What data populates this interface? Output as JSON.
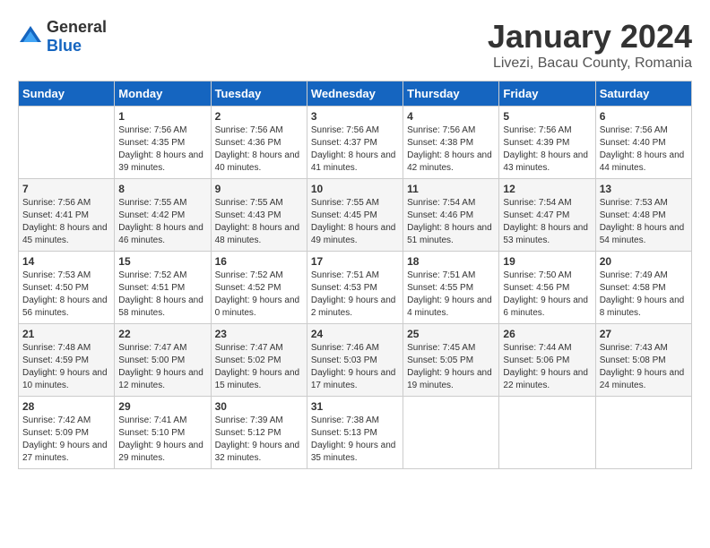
{
  "logo": {
    "general": "General",
    "blue": "Blue"
  },
  "title": "January 2024",
  "location": "Livezi, Bacau County, Romania",
  "days_of_week": [
    "Sunday",
    "Monday",
    "Tuesday",
    "Wednesday",
    "Thursday",
    "Friday",
    "Saturday"
  ],
  "weeks": [
    [
      {
        "day": "",
        "sunrise": "",
        "sunset": "",
        "daylight": ""
      },
      {
        "day": "1",
        "sunrise": "Sunrise: 7:56 AM",
        "sunset": "Sunset: 4:35 PM",
        "daylight": "Daylight: 8 hours and 39 minutes."
      },
      {
        "day": "2",
        "sunrise": "Sunrise: 7:56 AM",
        "sunset": "Sunset: 4:36 PM",
        "daylight": "Daylight: 8 hours and 40 minutes."
      },
      {
        "day": "3",
        "sunrise": "Sunrise: 7:56 AM",
        "sunset": "Sunset: 4:37 PM",
        "daylight": "Daylight: 8 hours and 41 minutes."
      },
      {
        "day": "4",
        "sunrise": "Sunrise: 7:56 AM",
        "sunset": "Sunset: 4:38 PM",
        "daylight": "Daylight: 8 hours and 42 minutes."
      },
      {
        "day": "5",
        "sunrise": "Sunrise: 7:56 AM",
        "sunset": "Sunset: 4:39 PM",
        "daylight": "Daylight: 8 hours and 43 minutes."
      },
      {
        "day": "6",
        "sunrise": "Sunrise: 7:56 AM",
        "sunset": "Sunset: 4:40 PM",
        "daylight": "Daylight: 8 hours and 44 minutes."
      }
    ],
    [
      {
        "day": "7",
        "sunrise": "Sunrise: 7:56 AM",
        "sunset": "Sunset: 4:41 PM",
        "daylight": "Daylight: 8 hours and 45 minutes."
      },
      {
        "day": "8",
        "sunrise": "Sunrise: 7:55 AM",
        "sunset": "Sunset: 4:42 PM",
        "daylight": "Daylight: 8 hours and 46 minutes."
      },
      {
        "day": "9",
        "sunrise": "Sunrise: 7:55 AM",
        "sunset": "Sunset: 4:43 PM",
        "daylight": "Daylight: 8 hours and 48 minutes."
      },
      {
        "day": "10",
        "sunrise": "Sunrise: 7:55 AM",
        "sunset": "Sunset: 4:45 PM",
        "daylight": "Daylight: 8 hours and 49 minutes."
      },
      {
        "day": "11",
        "sunrise": "Sunrise: 7:54 AM",
        "sunset": "Sunset: 4:46 PM",
        "daylight": "Daylight: 8 hours and 51 minutes."
      },
      {
        "day": "12",
        "sunrise": "Sunrise: 7:54 AM",
        "sunset": "Sunset: 4:47 PM",
        "daylight": "Daylight: 8 hours and 53 minutes."
      },
      {
        "day": "13",
        "sunrise": "Sunrise: 7:53 AM",
        "sunset": "Sunset: 4:48 PM",
        "daylight": "Daylight: 8 hours and 54 minutes."
      }
    ],
    [
      {
        "day": "14",
        "sunrise": "Sunrise: 7:53 AM",
        "sunset": "Sunset: 4:50 PM",
        "daylight": "Daylight: 8 hours and 56 minutes."
      },
      {
        "day": "15",
        "sunrise": "Sunrise: 7:52 AM",
        "sunset": "Sunset: 4:51 PM",
        "daylight": "Daylight: 8 hours and 58 minutes."
      },
      {
        "day": "16",
        "sunrise": "Sunrise: 7:52 AM",
        "sunset": "Sunset: 4:52 PM",
        "daylight": "Daylight: 9 hours and 0 minutes."
      },
      {
        "day": "17",
        "sunrise": "Sunrise: 7:51 AM",
        "sunset": "Sunset: 4:53 PM",
        "daylight": "Daylight: 9 hours and 2 minutes."
      },
      {
        "day": "18",
        "sunrise": "Sunrise: 7:51 AM",
        "sunset": "Sunset: 4:55 PM",
        "daylight": "Daylight: 9 hours and 4 minutes."
      },
      {
        "day": "19",
        "sunrise": "Sunrise: 7:50 AM",
        "sunset": "Sunset: 4:56 PM",
        "daylight": "Daylight: 9 hours and 6 minutes."
      },
      {
        "day": "20",
        "sunrise": "Sunrise: 7:49 AM",
        "sunset": "Sunset: 4:58 PM",
        "daylight": "Daylight: 9 hours and 8 minutes."
      }
    ],
    [
      {
        "day": "21",
        "sunrise": "Sunrise: 7:48 AM",
        "sunset": "Sunset: 4:59 PM",
        "daylight": "Daylight: 9 hours and 10 minutes."
      },
      {
        "day": "22",
        "sunrise": "Sunrise: 7:47 AM",
        "sunset": "Sunset: 5:00 PM",
        "daylight": "Daylight: 9 hours and 12 minutes."
      },
      {
        "day": "23",
        "sunrise": "Sunrise: 7:47 AM",
        "sunset": "Sunset: 5:02 PM",
        "daylight": "Daylight: 9 hours and 15 minutes."
      },
      {
        "day": "24",
        "sunrise": "Sunrise: 7:46 AM",
        "sunset": "Sunset: 5:03 PM",
        "daylight": "Daylight: 9 hours and 17 minutes."
      },
      {
        "day": "25",
        "sunrise": "Sunrise: 7:45 AM",
        "sunset": "Sunset: 5:05 PM",
        "daylight": "Daylight: 9 hours and 19 minutes."
      },
      {
        "day": "26",
        "sunrise": "Sunrise: 7:44 AM",
        "sunset": "Sunset: 5:06 PM",
        "daylight": "Daylight: 9 hours and 22 minutes."
      },
      {
        "day": "27",
        "sunrise": "Sunrise: 7:43 AM",
        "sunset": "Sunset: 5:08 PM",
        "daylight": "Daylight: 9 hours and 24 minutes."
      }
    ],
    [
      {
        "day": "28",
        "sunrise": "Sunrise: 7:42 AM",
        "sunset": "Sunset: 5:09 PM",
        "daylight": "Daylight: 9 hours and 27 minutes."
      },
      {
        "day": "29",
        "sunrise": "Sunrise: 7:41 AM",
        "sunset": "Sunset: 5:10 PM",
        "daylight": "Daylight: 9 hours and 29 minutes."
      },
      {
        "day": "30",
        "sunrise": "Sunrise: 7:39 AM",
        "sunset": "Sunset: 5:12 PM",
        "daylight": "Daylight: 9 hours and 32 minutes."
      },
      {
        "day": "31",
        "sunrise": "Sunrise: 7:38 AM",
        "sunset": "Sunset: 5:13 PM",
        "daylight": "Daylight: 9 hours and 35 minutes."
      },
      {
        "day": "",
        "sunrise": "",
        "sunset": "",
        "daylight": ""
      },
      {
        "day": "",
        "sunrise": "",
        "sunset": "",
        "daylight": ""
      },
      {
        "day": "",
        "sunrise": "",
        "sunset": "",
        "daylight": ""
      }
    ]
  ]
}
